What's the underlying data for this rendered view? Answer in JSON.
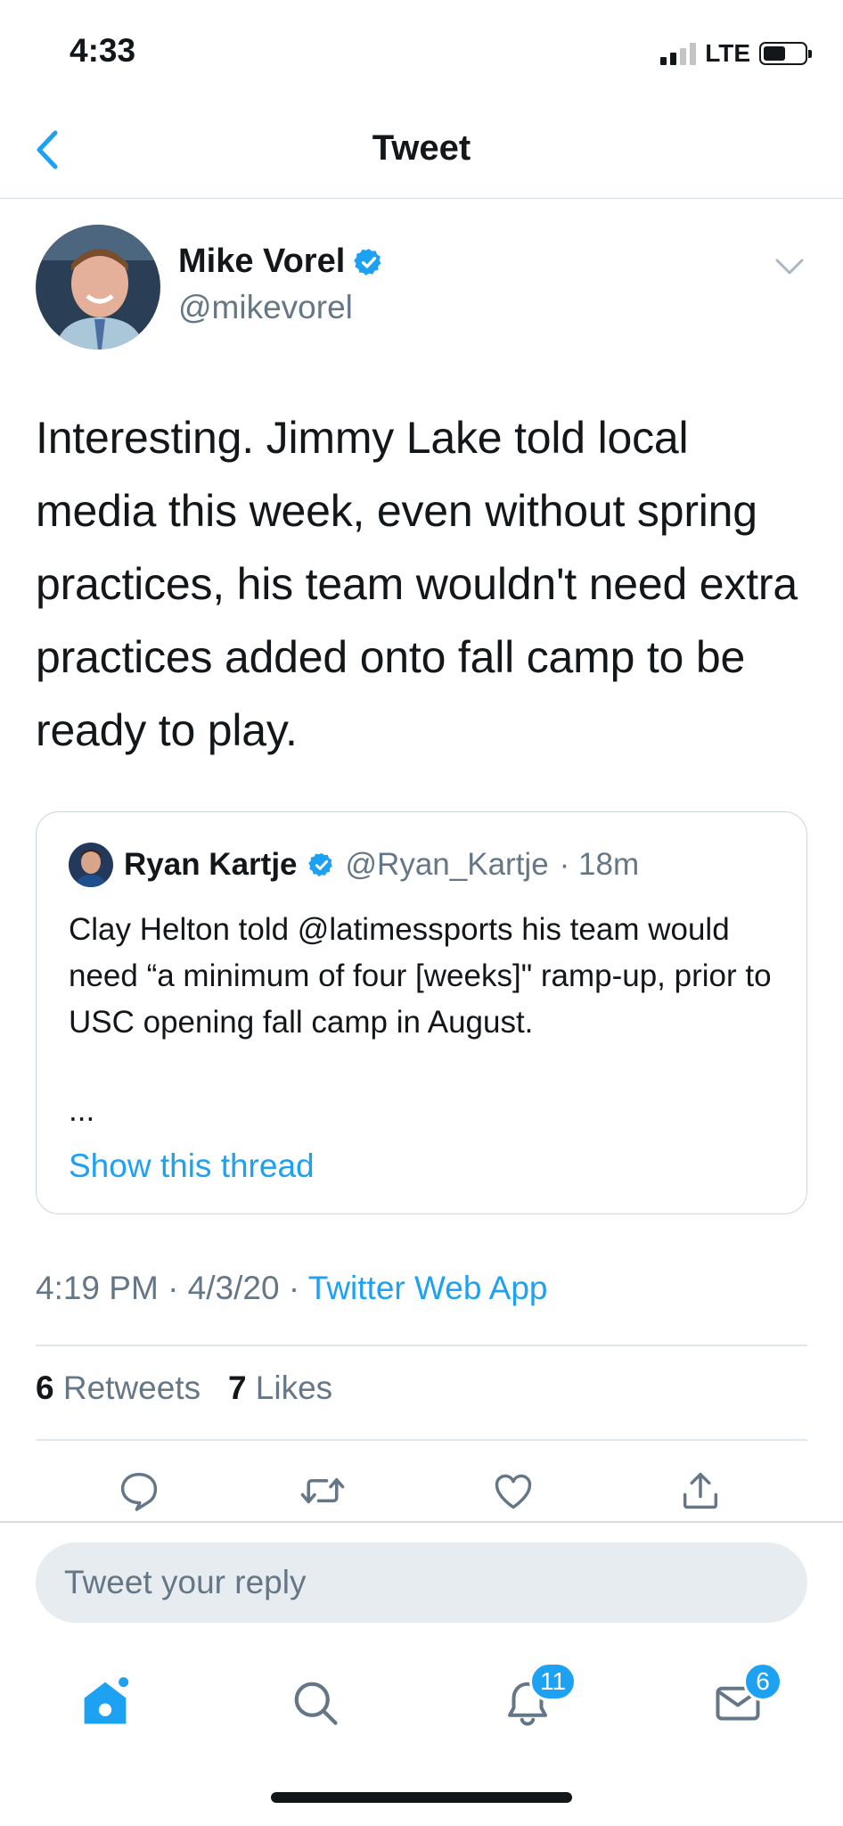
{
  "status_bar": {
    "time": "4:33",
    "network": "LTE"
  },
  "header": {
    "title": "Tweet"
  },
  "tweet": {
    "author_name": "Mike Vorel",
    "author_handle": "@mikevorel",
    "text": "Interesting. Jimmy Lake told local media this week, even without spring practices, his team wouldn't need extra practices added onto fall camp to be ready to play.",
    "timestamp": "4:19 PM · 4/3/20 · ",
    "source": "Twitter Web App",
    "retweet_count": "6",
    "retweet_label": "Retweets",
    "like_count": "7",
    "like_label": "Likes"
  },
  "quoted_tweet": {
    "author_name": "Ryan Kartje",
    "author_handle": "@Ryan_Kartje",
    "time": "· 18m",
    "text": "Clay Helton told @latimessports his team would need “a minimum of four [weeks]\" ramp-up, prior to USC opening fall camp in August.",
    "ellipsis": "...",
    "show_thread": "Show this thread"
  },
  "reply": {
    "placeholder": "Tweet your reply"
  },
  "tab_bar": {
    "notifications_badge": "11",
    "messages_badge": "6"
  },
  "colors": {
    "accent": "#1da1f2",
    "secondary_text": "#657786",
    "primary_text": "#14171a"
  },
  "icons": [
    "chevron-left-icon",
    "verified-badge-icon",
    "chevron-down-icon",
    "reply-icon",
    "retweet-icon",
    "like-icon",
    "share-icon",
    "home-icon",
    "search-icon",
    "notifications-icon",
    "messages-icon"
  ]
}
